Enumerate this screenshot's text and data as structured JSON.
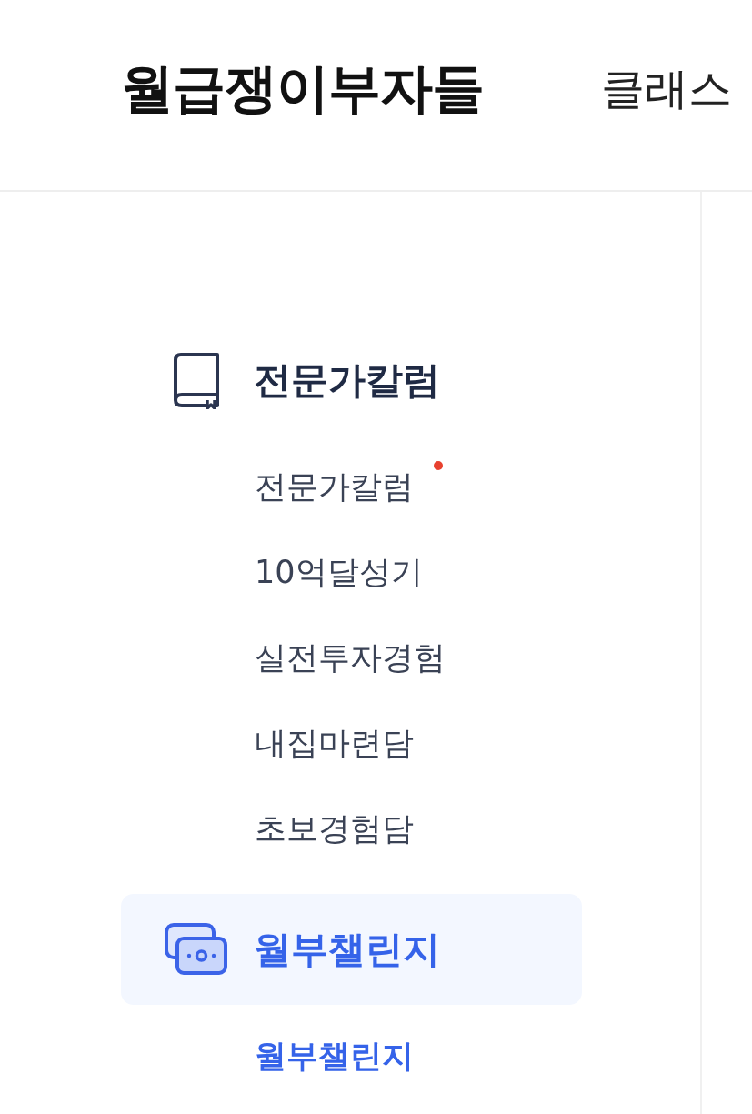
{
  "header": {
    "logo": "월급쟁이부자들",
    "nav": [
      {
        "label": "클래스"
      }
    ]
  },
  "sidebar": {
    "sections": [
      {
        "title": "전문가칼럼",
        "selected": false,
        "items": [
          {
            "label": "전문가칼럼",
            "new": true,
            "selected": false
          },
          {
            "label": "10억달성기",
            "new": false,
            "selected": false
          },
          {
            "label": "실전투자경험",
            "new": false,
            "selected": false
          },
          {
            "label": "내집마련담",
            "new": false,
            "selected": false
          },
          {
            "label": "초보경험담",
            "new": false,
            "selected": false
          }
        ]
      },
      {
        "title": "월부챌린지",
        "selected": true,
        "items": [
          {
            "label": "월부챌린지",
            "new": false,
            "selected": true
          }
        ]
      }
    ]
  }
}
